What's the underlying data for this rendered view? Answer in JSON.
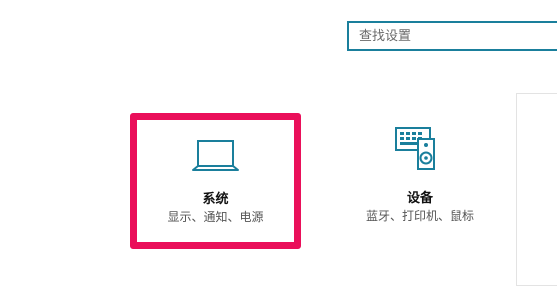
{
  "search": {
    "placeholder": "查找设置",
    "value": ""
  },
  "tiles": [
    {
      "title": "系统",
      "description": "显示、通知、电源",
      "icon": "laptop-icon",
      "highlighted": true
    },
    {
      "title": "设备",
      "description": "蓝牙、打印机、鼠标",
      "icon": "keyboard-speaker-icon",
      "highlighted": false
    }
  ],
  "colors": {
    "accent": "#1a7f9c",
    "highlight_border": "#ea0f5a"
  }
}
